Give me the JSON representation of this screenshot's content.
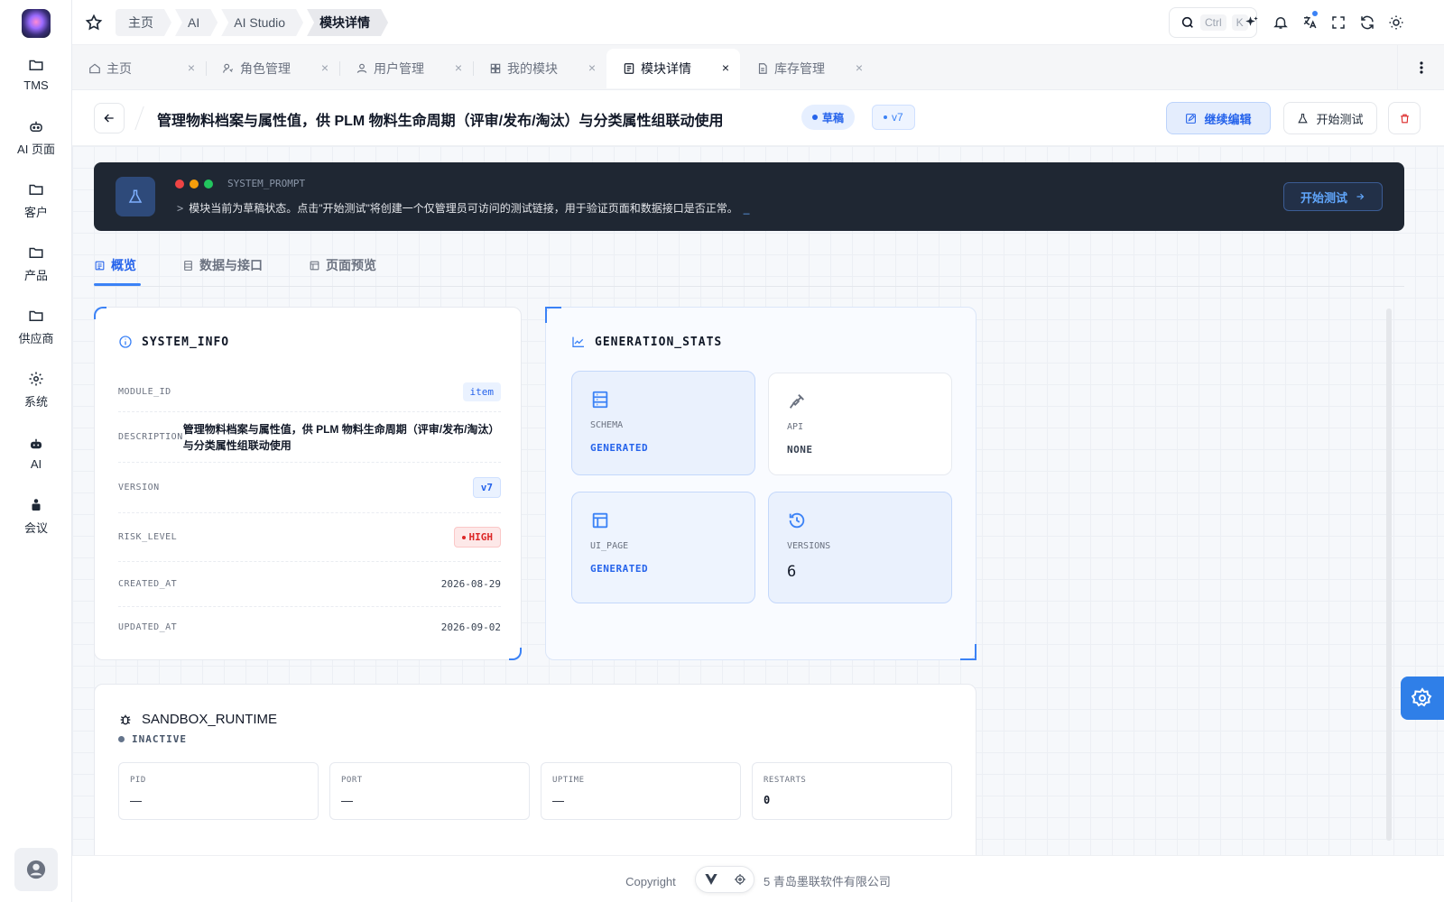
{
  "sidebar": {
    "items": [
      {
        "label": "TMS",
        "icon": "folder-icon"
      },
      {
        "label": "AI 页面",
        "icon": "robot-icon"
      },
      {
        "label": "客户",
        "icon": "folder-icon"
      },
      {
        "label": "产品",
        "icon": "folder-icon"
      },
      {
        "label": "供应商",
        "icon": "folder-icon"
      },
      {
        "label": "系统",
        "icon": "gear-icon"
      },
      {
        "label": "AI",
        "icon": "robot-icon"
      },
      {
        "label": "会议",
        "icon": "meeting-icon"
      }
    ]
  },
  "breadcrumb": [
    "主页",
    "AI",
    "AI Studio",
    "模块详情"
  ],
  "search": {
    "key1": "Ctrl",
    "key2": "K"
  },
  "tabs": [
    {
      "label": "主页",
      "icon": "home-icon"
    },
    {
      "label": "角色管理",
      "icon": "user-key-icon"
    },
    {
      "label": "用户管理",
      "icon": "user-icon"
    },
    {
      "label": "我的模块",
      "icon": "grid-icon"
    },
    {
      "label": "模块详情",
      "icon": "doc-icon",
      "active": true
    },
    {
      "label": "库存管理",
      "icon": "file-icon"
    }
  ],
  "tab_close": "×",
  "page": {
    "title": "管理物料档案与属性值，供 PLM 物料生命周期（评审/发布/淘汰）与分类属性组联动使用",
    "status_badge": "草稿",
    "version_badge": "v7",
    "btn_edit": "继续编辑",
    "btn_test": "开始测试"
  },
  "banner": {
    "label": "SYSTEM_PROMPT",
    "prompt": ">",
    "message": "模块当前为草稿状态。点击\"开始测试\"将创建一个仅管理员可访问的测试链接，用于验证页面和数据接口是否正常。",
    "cursor": "_",
    "button": "开始测试"
  },
  "content_tabs": [
    {
      "label": "概览",
      "active": true
    },
    {
      "label": "数据与接口"
    },
    {
      "label": "页面预览"
    }
  ],
  "system_info": {
    "title": "SYSTEM_INFO",
    "rows": [
      {
        "key": "MODULE_ID",
        "value": "item"
      },
      {
        "key": "DESCRIPTION",
        "value": "管理物料档案与属性值，供 PLM 物料生命周期（评审/发布/淘汰）与分类属性组联动使用"
      },
      {
        "key": "VERSION",
        "value": "v7"
      },
      {
        "key": "RISK_LEVEL",
        "value": "HIGH"
      },
      {
        "key": "CREATED_AT",
        "value": "2026-08-29"
      },
      {
        "key": "UPDATED_AT",
        "value": "2026-09-02"
      }
    ]
  },
  "generation_stats": {
    "title": "GENERATION_STATS",
    "items": [
      {
        "key": "SCHEMA",
        "value": "GENERATED"
      },
      {
        "key": "API",
        "value": "NONE"
      },
      {
        "key": "UI_PAGE",
        "value": "GENERATED"
      },
      {
        "key": "VERSIONS",
        "value": "6"
      }
    ]
  },
  "sandbox": {
    "title": "SANDBOX_RUNTIME",
    "status": "INACTIVE",
    "fields": [
      {
        "key": "PID",
        "value": "—"
      },
      {
        "key": "PORT",
        "value": "—"
      },
      {
        "key": "UPTIME",
        "value": "—"
      },
      {
        "key": "RESTARTS",
        "value": "0"
      }
    ]
  },
  "footer": {
    "left": "Copyright",
    "right": "5 青岛墨联软件有限公司"
  },
  "colors": {
    "accent": "#3b82f6",
    "danger": "#dc2626",
    "banner_bg": "#1f2733"
  }
}
